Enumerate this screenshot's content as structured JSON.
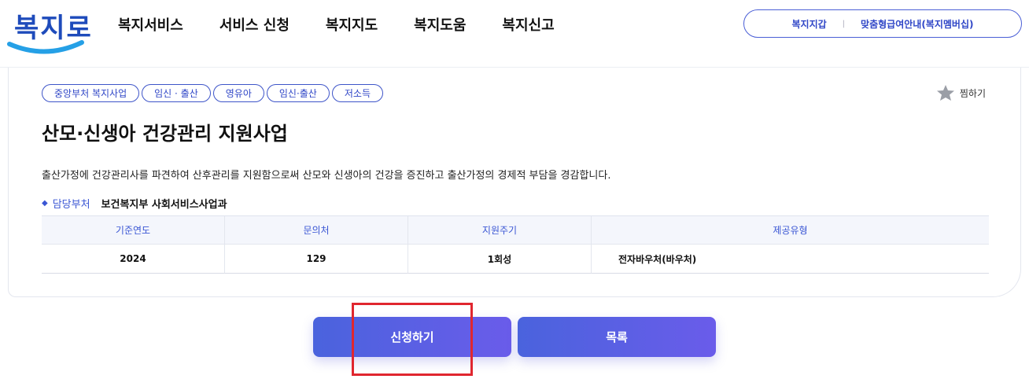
{
  "logo": {
    "text": "복지로"
  },
  "nav": [
    {
      "label": "복지서비스"
    },
    {
      "label": "서비스 신청"
    },
    {
      "label": "복지지도"
    },
    {
      "label": "복지도움"
    },
    {
      "label": "복지신고"
    }
  ],
  "util": {
    "wallet": "복지지갑",
    "separator": "|",
    "membership": "맞춤형급여안내(복지멤버십)"
  },
  "detail": {
    "tags": [
      "중앙부처 복지사업",
      "임신 · 출산",
      "영유아",
      "임신·출산",
      "저소득"
    ],
    "favorite_label": "찜하기",
    "title": "산모·신생아 건강관리 지원사업",
    "description": "출산가정에 건강관리사를 파견하여 산후관리를 지원함으로써 산모와 신생아의 건강을 증진하고 출산가정의 경제적 부담을 경감합니다.",
    "department_label": "담당부처",
    "department_value": "보건복지부 사회서비스사업과",
    "table": {
      "headers": [
        "기준연도",
        "문의처",
        "지원주기",
        "제공유형"
      ],
      "row": [
        "2024",
        "129",
        "1회성",
        "전자바우처(바우처)"
      ]
    }
  },
  "buttons": {
    "apply": "신청하기",
    "list": "목록"
  },
  "colors": {
    "brand": "#2f46c7",
    "button_start": "#4a63dd",
    "button_end": "#6a5cea",
    "highlight": "#e0262f"
  }
}
